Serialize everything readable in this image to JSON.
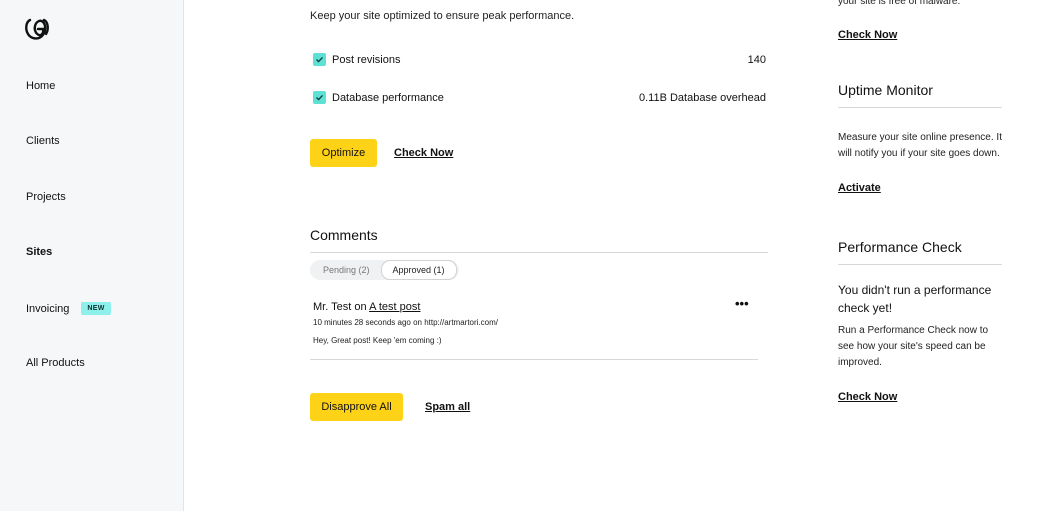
{
  "sidebar": {
    "items": [
      {
        "label": "Home"
      },
      {
        "label": "Clients"
      },
      {
        "label": "Projects"
      },
      {
        "label": "Sites"
      },
      {
        "label": "Invoicing",
        "badge": "NEW"
      },
      {
        "label": "All Products"
      }
    ]
  },
  "optimize": {
    "intro": "Keep your site optimized to ensure peak performance.",
    "rows": [
      {
        "label": "Post revisions",
        "value": "140"
      },
      {
        "label": "Database performance",
        "value": "0.11B Database overhead"
      }
    ],
    "optimize_label": "Optimize",
    "check_now_label": "Check Now"
  },
  "comments": {
    "title": "Comments",
    "tabs": [
      "Pending (2)",
      "Approved (1)"
    ],
    "comment": {
      "author": "Mr. Test",
      "on": "on",
      "post": "A test post",
      "meta": "10 minutes 28 seconds ago on http://artmartori.com/",
      "body": "Hey,  Great post! Keep 'em coming :)"
    },
    "disapprove_label": "Disapprove All",
    "spam_label": "Spam all"
  },
  "right": {
    "malware_text": "your site is free of malware.",
    "malware_link": "Check Now",
    "uptime_title": "Uptime Monitor",
    "uptime_text": "Measure your site online presence. It will notify you if your site goes down.",
    "uptime_link": "Activate",
    "perf_title": "Performance Check",
    "perf_heading": "You didn't run a performance check yet!",
    "perf_text": "Run a Performance Check now to see how your site's speed can be improved.",
    "perf_link": "Check Now"
  },
  "colors": {
    "accent_yellow": "#fed317",
    "checkbox_teal": "#5ee0d5",
    "badge_teal": "#8ef0ea"
  }
}
